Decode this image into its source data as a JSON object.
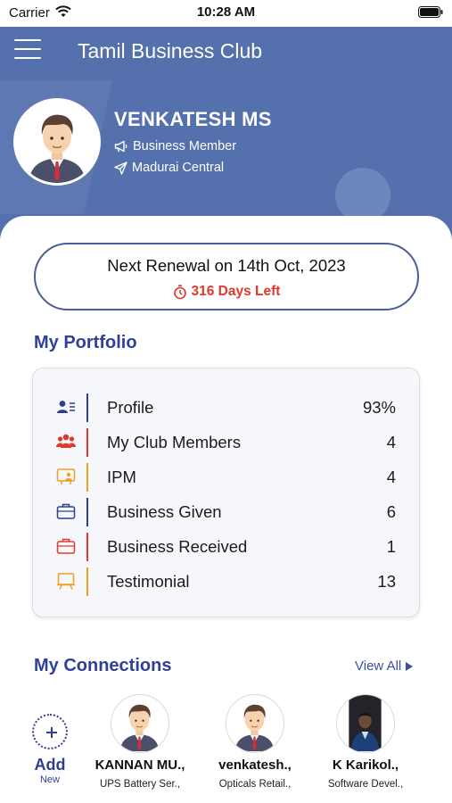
{
  "status_bar": {
    "carrier": "Carrier",
    "time": "10:28 AM"
  },
  "header": {
    "title": "Tamil Business Club",
    "user_name": "VENKATESH MS",
    "role": "Business Member",
    "location": "Madurai Central"
  },
  "renewal": {
    "title": "Next Renewal on 14th Oct, 2023",
    "days_left": "316 Days Left"
  },
  "portfolio": {
    "title": "My Portfolio",
    "items": [
      {
        "label": "Profile",
        "value": "93%",
        "icon": "id-card-icon",
        "color": "#2f3f8f"
      },
      {
        "label": "My Club Members",
        "value": "4",
        "icon": "group-icon",
        "color": "#e0382f"
      },
      {
        "label": "IPM",
        "value": "4",
        "icon": "presentation-user-icon",
        "color": "#f0a020"
      },
      {
        "label": "Business Given",
        "value": "6",
        "icon": "briefcase-icon",
        "color": "#2f3f8f"
      },
      {
        "label": "Business Received",
        "value": "1",
        "icon": "briefcase-icon",
        "color": "#e0382f"
      },
      {
        "label": "Testimonial",
        "value": "13",
        "icon": "easel-icon",
        "color": "#f0a020"
      }
    ]
  },
  "connections": {
    "title": "My Connections",
    "view_all": "View All",
    "add_label": "Add",
    "add_sub": "New",
    "items": [
      {
        "name": "KANNAN MU.,",
        "subtitle": "UPS Battery Ser.,"
      },
      {
        "name": "venkatesh.,",
        "subtitle": "Opticals Retail.,"
      },
      {
        "name": "K Karikol.,",
        "subtitle": "Software Devel.,"
      }
    ]
  },
  "colors": {
    "header_bg": "#5470ad",
    "accent": "#30409a",
    "alert": "#e0382f",
    "orange": "#f0a020"
  }
}
